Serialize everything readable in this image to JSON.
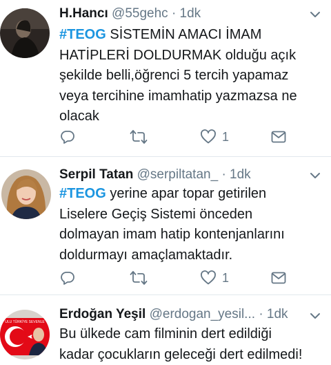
{
  "tweets": [
    {
      "name": "H.Hancı",
      "handle": "@55gehc",
      "separator": "·",
      "time": "1dk",
      "hashtag": "#TEOG",
      "text_lines": [
        " SİSTEMİN AMACI İMAM",
        "HATİPLERİ DOLDURMAK olduğu açık",
        "şekilde belli,öğrenci 5 tercih yapamaz",
        "veya tercihine imamhatip yazmazsa ne",
        "olacak"
      ],
      "like_count": "1"
    },
    {
      "name": "Serpil Tatan",
      "handle": "@serpiltatan_",
      "separator": "·",
      "time": "1dk",
      "hashtag": "#TEOG",
      "text_lines": [
        " yerine apar topar getirilen",
        "Liselere Geçiş Sistemi önceden",
        "dolmayan imam hatip kontenjanlarını",
        "doldurmayı amaçlamaktadır."
      ],
      "like_count": "1"
    },
    {
      "name": "Erdoğan Yeşil",
      "handle": "@erdogan_yesil...",
      "separator": "·",
      "time": "1dk",
      "avatar_banner_text": "ULU TÜRKİYE SEVENLE",
      "text_lines": [
        "Bu ülkede cam filminin dert edildiği",
        "kadar çocukların geleceği dert edilmedi!"
      ]
    }
  ],
  "icons": {
    "reply": "reply-icon",
    "retweet": "retweet-icon",
    "like": "heart-icon",
    "dm": "envelope-icon",
    "menu": "chevron-down-icon"
  },
  "colors": {
    "hashtag": "#1b95e0",
    "secondary_text": "#657786",
    "icon": "#657786",
    "divider": "#e1e8ed"
  }
}
